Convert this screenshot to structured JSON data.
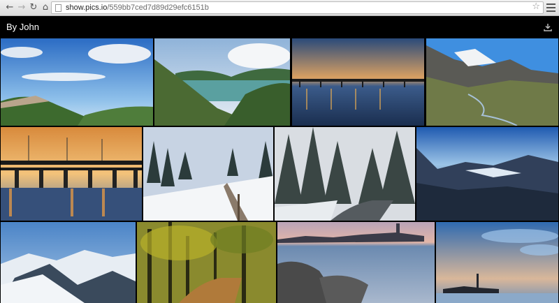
{
  "browser": {
    "url_host": "show.pics.io",
    "url_path": "/559bb7ced7d89d29efc6151b",
    "back_icon": "arrow-left-icon",
    "forward_icon": "arrow-right-icon",
    "reload_icon": "reload-icon",
    "home_icon": "home-icon",
    "bookmark_icon": "star-icon",
    "menu_icon": "hamburger-icon"
  },
  "gallery": {
    "title": "By John",
    "download_icon": "download-icon",
    "photos": [
      "Coastal village beneath blue sky with clouds",
      "Turquoise lake among green hills",
      "Long pier at dusk",
      "Alpine valley with river",
      "Bridge at sunset",
      "Snowy forest road with fence",
      "Snow covered pine trees",
      "Mountain range at twilight",
      "Snowy mountain peaks",
      "Autumn forest path",
      "Waterfront town at evening",
      "Island church across calm sea"
    ]
  }
}
